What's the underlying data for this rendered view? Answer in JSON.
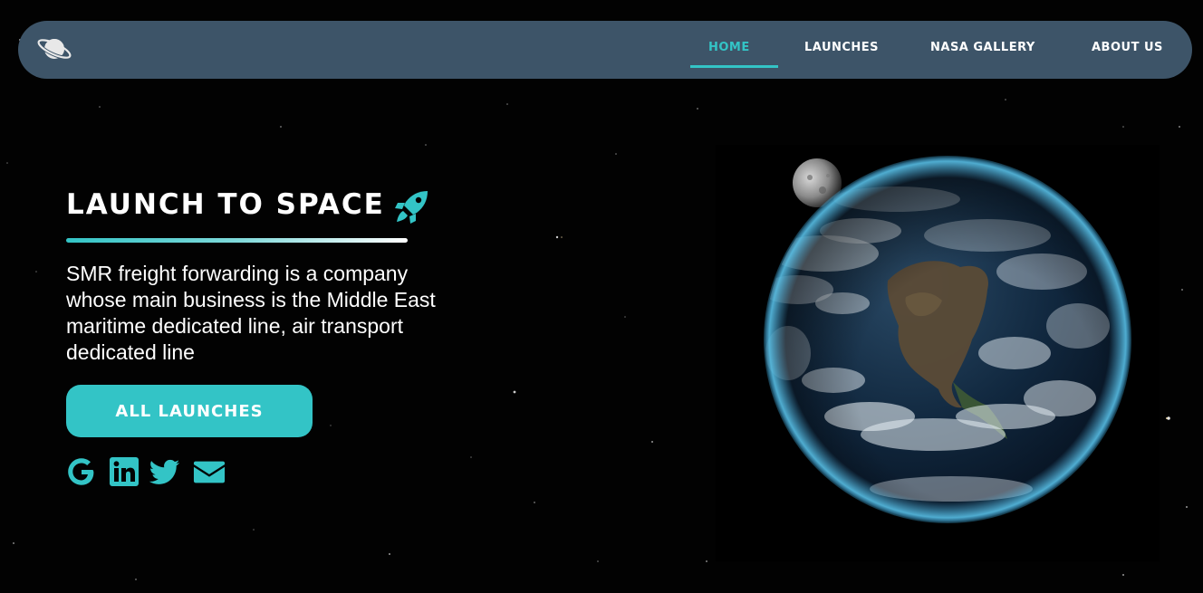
{
  "nav": {
    "logo_icon": "saturn-icon",
    "items": [
      {
        "label": "HOME",
        "active": true
      },
      {
        "label": "LAUNCHES",
        "active": false
      },
      {
        "label": "NASA GALLERY",
        "active": false
      },
      {
        "label": "ABOUT US",
        "active": false
      }
    ]
  },
  "hero": {
    "title": "LAUNCH TO SPACE",
    "title_icon": "rocket-icon",
    "description": "SMR freight forwarding is a company whose main business is the Middle East maritime dedicated line, air transport dedicated line",
    "cta_label": "ALL LAUNCHES",
    "social_icons": [
      "google-icon",
      "linkedin-icon",
      "twitter-icon",
      "envelope-icon"
    ]
  },
  "colors": {
    "accent": "#33c4c6",
    "navbar": "#3d5468",
    "background": "#020202",
    "text": "#ffffff"
  }
}
